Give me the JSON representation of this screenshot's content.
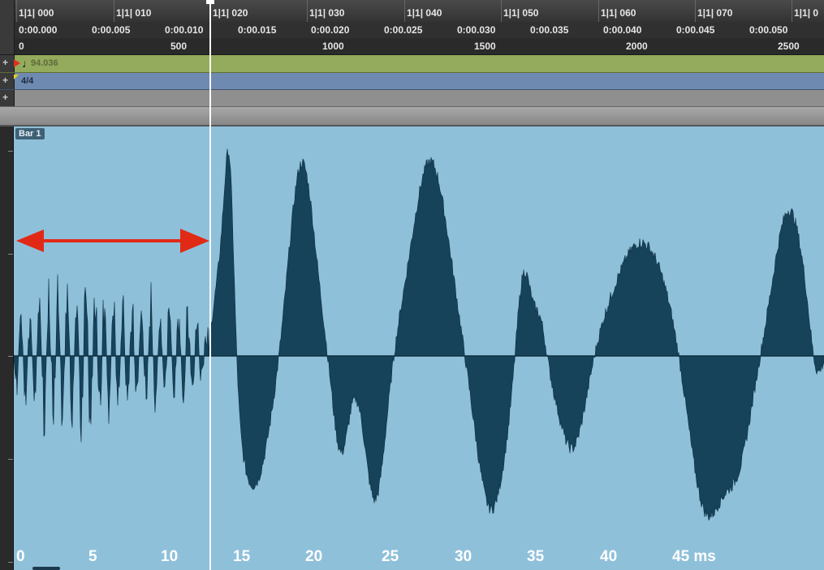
{
  "rulers": {
    "bars": [
      "1|1| 000",
      "1|1| 010",
      "1|1| 020",
      "1|1| 030",
      "1|1| 040",
      "1|1| 050",
      "1|1| 060",
      "1|1| 070",
      "1|1| 0"
    ],
    "time": [
      "0:00.000",
      "0:00.005",
      "0:00.010",
      "0:00.015",
      "0:00.020",
      "0:00.025",
      "0:00.030",
      "0:00.035",
      "0:00.040",
      "0:00.045",
      "0:00.050"
    ],
    "samples": [
      "0",
      "500",
      "1000",
      "1500",
      "2000",
      "2500"
    ]
  },
  "lanes": {
    "add_icon": "+",
    "tempo_value": "94.036",
    "tempo_icon": "note-icon",
    "meter_value": "4/4"
  },
  "clip": {
    "label": "Bar 1"
  },
  "ms_axis": {
    "labels": [
      "0",
      "5",
      "10",
      "15",
      "20",
      "25",
      "30",
      "35",
      "40",
      "45 ms"
    ]
  },
  "colors": {
    "track_background": "#8fc0da",
    "waveform_fill": "#16435a",
    "arrow": "#e02a16",
    "playhead": "#ffffff"
  }
}
